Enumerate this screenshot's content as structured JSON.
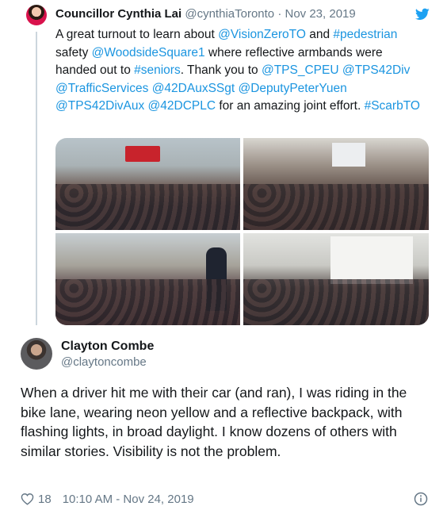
{
  "parent_tweet": {
    "name": "Councillor Cynthia Lai",
    "handle": "@cynthiaToronto",
    "separator": "·",
    "date": "Nov 23, 2019",
    "text_segments": [
      {
        "text": "A great turnout to learn about ",
        "link": false
      },
      {
        "text": "@VisionZeroTO",
        "link": true
      },
      {
        "text": " and ",
        "link": false
      },
      {
        "text": "#pedestrian",
        "link": true
      },
      {
        "text": " safety ",
        "link": false
      },
      {
        "text": "@WoodsideSquare1",
        "link": true
      },
      {
        "text": " where reflective armbands were handed out to ",
        "link": false
      },
      {
        "text": "#seniors",
        "link": true
      },
      {
        "text": ". Thank you to ",
        "link": false
      },
      {
        "text": "@TPS_CPEU",
        "link": true
      },
      {
        "text": " ",
        "link": false
      },
      {
        "text": "@TPS42Div",
        "link": true
      },
      {
        "text": " ",
        "link": false
      },
      {
        "text": "@TrafficServices",
        "link": true
      },
      {
        "text": "  ",
        "link": false
      },
      {
        "text": "@42DAuxSSgt",
        "link": true
      },
      {
        "text": " ",
        "link": false
      },
      {
        "text": "@DeputyPeterYuen",
        "link": true
      },
      {
        "text": " ",
        "link": false
      },
      {
        "text": "@TPS42DivAux",
        "link": true
      },
      {
        "text": " ",
        "link": false
      },
      {
        "text": "@42DCPLC",
        "link": true
      },
      {
        "text": " for an amazing joint effort. ",
        "link": false
      },
      {
        "text": "#ScarbTO",
        "link": true
      }
    ],
    "photo_count": 4
  },
  "reply_tweet": {
    "name": "Clayton Combe",
    "handle": "@claytoncombe",
    "text": "When a driver hit me with their car (and ran), I was riding in the bike lane, wearing neon yellow and a reflective backpack, with flashing lights, in broad daylight. I know dozens of others with similar stories. Visibility is not the problem.",
    "likes": "18",
    "timestamp": "10:10 AM - Nov 24, 2019"
  },
  "colors": {
    "link": "#1b95e0",
    "secondary_text": "#657786",
    "twitter_blue": "#1da1f2"
  },
  "icons": {
    "brand": "twitter-bird-icon",
    "like": "heart-icon",
    "info": "info-icon"
  }
}
